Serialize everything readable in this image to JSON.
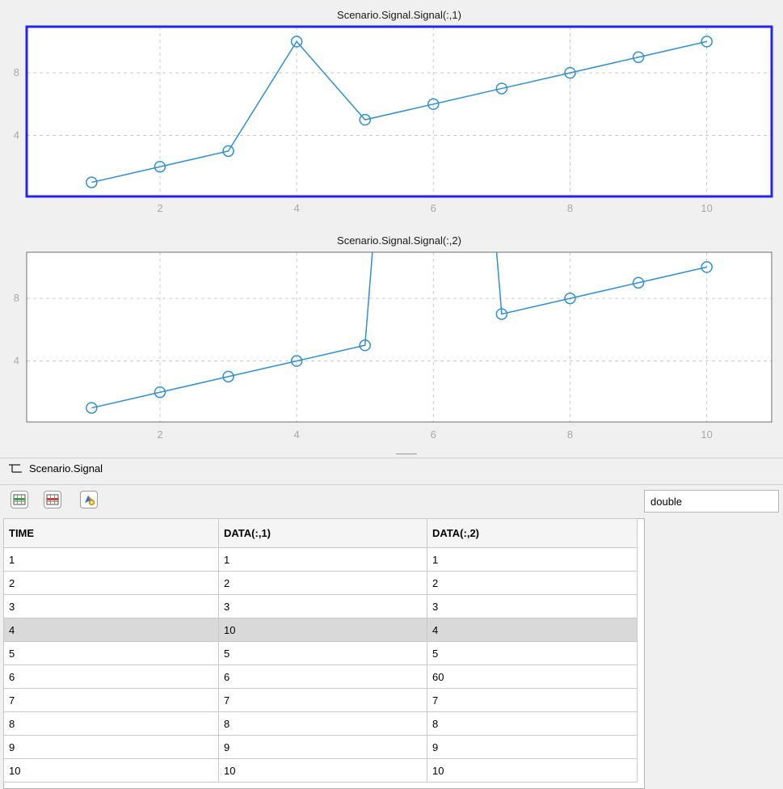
{
  "chart_data": [
    {
      "type": "line",
      "title": "Scenario.Signal.Signal(:,1)",
      "x": [
        1,
        2,
        3,
        4,
        5,
        6,
        7,
        8,
        9,
        10
      ],
      "y": [
        1,
        2,
        3,
        10,
        5,
        6,
        7,
        8,
        9,
        10
      ],
      "xlim": [
        0.05,
        10.95
      ],
      "ylim": [
        0.1,
        10.95
      ],
      "xticks": [
        2,
        4,
        6,
        8,
        10
      ],
      "yticks": [
        4,
        8
      ],
      "grid": true,
      "marker": "circle",
      "selected": true
    },
    {
      "type": "line",
      "title": "Scenario.Signal.Signal(:,2)",
      "x": [
        1,
        2,
        3,
        4,
        5,
        6,
        7,
        8,
        9,
        10
      ],
      "y": [
        1,
        2,
        3,
        4,
        5,
        60,
        7,
        8,
        9,
        10
      ],
      "xlim": [
        0.05,
        10.95
      ],
      "ylim": [
        0.1,
        10.95
      ],
      "xticks": [
        2,
        4,
        6,
        8,
        10
      ],
      "yticks": [
        4,
        8
      ],
      "grid": true,
      "marker": "circle",
      "selected": false
    }
  ],
  "colors": {
    "line": "#2f8fd0",
    "selected_axes": "#2323f2",
    "grid": "#c9c9c9",
    "tick": "#a8a8a8"
  },
  "variable": {
    "name": "Scenario.Signal",
    "icon": "tree-icon"
  },
  "toolbar": {
    "icons": [
      "add-row-icon",
      "delete-row-icon",
      "plot-icon"
    ],
    "type_value": "double"
  },
  "table": {
    "headers": [
      "TIME",
      "DATA(:,1)",
      "DATA(:,2)"
    ],
    "rows": [
      [
        "1",
        "1",
        "1"
      ],
      [
        "2",
        "2",
        "2"
      ],
      [
        "3",
        "3",
        "3"
      ],
      [
        "4",
        "10",
        "4"
      ],
      [
        "5",
        "5",
        "5"
      ],
      [
        "6",
        "6",
        "60"
      ],
      [
        "7",
        "7",
        "7"
      ],
      [
        "8",
        "8",
        "8"
      ],
      [
        "9",
        "9",
        "9"
      ],
      [
        "10",
        "10",
        "10"
      ]
    ],
    "selected_row": 3
  }
}
